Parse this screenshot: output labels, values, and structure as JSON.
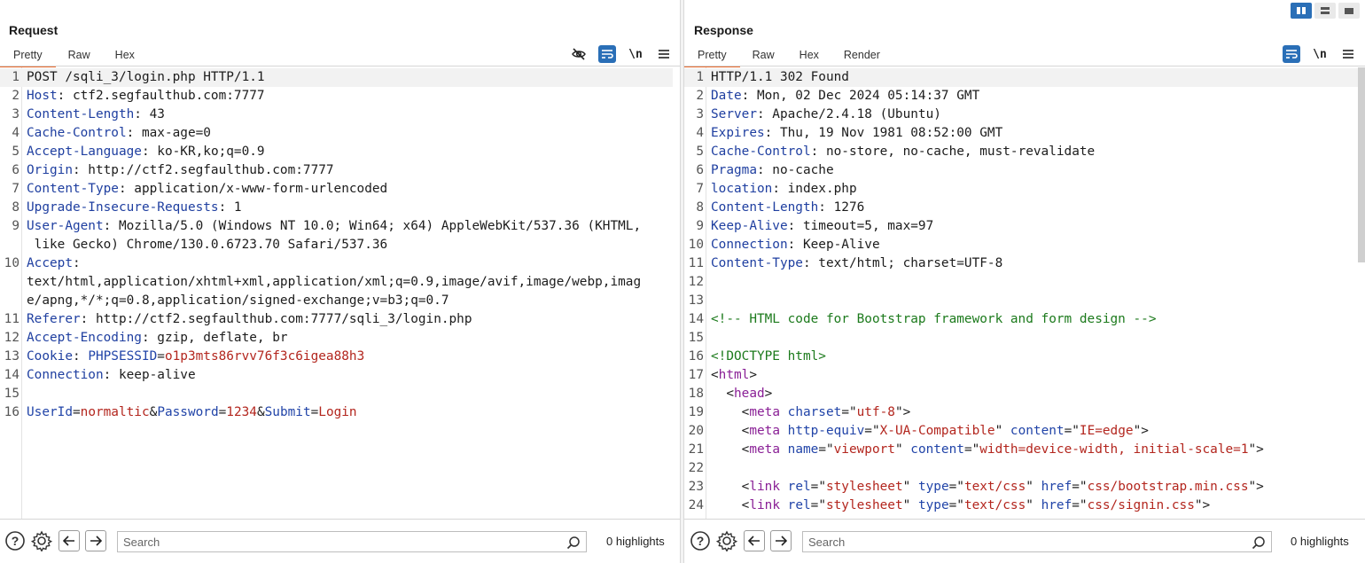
{
  "request": {
    "title": "Request",
    "tabs": [
      "Pretty",
      "Raw",
      "Hex"
    ],
    "toolbar": {
      "newline_label": "\\n"
    },
    "lines": [
      {
        "n": "1",
        "hl": true,
        "parts": [
          [
            "t",
            "POST /sqli_3/login.php HTTP/1.1"
          ]
        ]
      },
      {
        "n": "2",
        "parts": [
          [
            "k",
            "Host"
          ],
          [
            "t",
            ": ctf2.segfaulthub.com:7777"
          ]
        ]
      },
      {
        "n": "3",
        "parts": [
          [
            "k",
            "Content-Length"
          ],
          [
            "t",
            ": 43"
          ]
        ]
      },
      {
        "n": "4",
        "parts": [
          [
            "k",
            "Cache-Control"
          ],
          [
            "t",
            ": max-age=0"
          ]
        ]
      },
      {
        "n": "5",
        "parts": [
          [
            "k",
            "Accept-Language"
          ],
          [
            "t",
            ": ko-KR,ko;q=0.9"
          ]
        ]
      },
      {
        "n": "6",
        "parts": [
          [
            "k",
            "Origin"
          ],
          [
            "t",
            ": http://ctf2.segfaulthub.com:7777"
          ]
        ]
      },
      {
        "n": "7",
        "parts": [
          [
            "k",
            "Content-Type"
          ],
          [
            "t",
            ": application/x-www-form-urlencoded"
          ]
        ]
      },
      {
        "n": "8",
        "parts": [
          [
            "k",
            "Upgrade-Insecure-Requests"
          ],
          [
            "t",
            ": 1"
          ]
        ]
      },
      {
        "n": "9",
        "parts": [
          [
            "k",
            "User-Agent"
          ],
          [
            "t",
            ": Mozilla/5.0 (Windows NT 10.0; Win64; x64) AppleWebKit/537.36 (KHTML,"
          ]
        ]
      },
      {
        "n": "",
        "parts": [
          [
            "t",
            " like Gecko) Chrome/130.0.6723.70 Safari/537.36"
          ]
        ]
      },
      {
        "n": "10",
        "parts": [
          [
            "k",
            "Accept"
          ],
          [
            "t",
            ":"
          ]
        ]
      },
      {
        "n": "",
        "parts": [
          [
            "t",
            "text/html,application/xhtml+xml,application/xml;q=0.9,image/avif,image/webp,imag"
          ]
        ]
      },
      {
        "n": "",
        "parts": [
          [
            "t",
            "e/apng,*/*;q=0.8,application/signed-exchange;v=b3;q=0.7"
          ]
        ]
      },
      {
        "n": "11",
        "parts": [
          [
            "k",
            "Referer"
          ],
          [
            "t",
            ": http://ctf2.segfaulthub.com:7777/sqli_3/login.php"
          ]
        ]
      },
      {
        "n": "12",
        "parts": [
          [
            "k",
            "Accept-Encoding"
          ],
          [
            "t",
            ": gzip, deflate, br"
          ]
        ]
      },
      {
        "n": "13",
        "parts": [
          [
            "k",
            "Cookie"
          ],
          [
            "t",
            ": "
          ],
          [
            "pk",
            "PHPSESSID"
          ],
          [
            "t",
            "="
          ],
          [
            "pv",
            "o1p3mts86rvv76f3c6igea88h3"
          ]
        ]
      },
      {
        "n": "14",
        "parts": [
          [
            "k",
            "Connection"
          ],
          [
            "t",
            ": keep-alive"
          ]
        ]
      },
      {
        "n": "15",
        "parts": [
          [
            "t",
            ""
          ]
        ]
      },
      {
        "n": "16",
        "parts": [
          [
            "pk",
            "UserId"
          ],
          [
            "t",
            "="
          ],
          [
            "pv",
            "normaltic"
          ],
          [
            "t",
            "&"
          ],
          [
            "pk",
            "Password"
          ],
          [
            "t",
            "="
          ],
          [
            "pv",
            "1234"
          ],
          [
            "t",
            "&"
          ],
          [
            "pk",
            "Submit"
          ],
          [
            "t",
            "="
          ],
          [
            "pv",
            "Login"
          ]
        ]
      }
    ],
    "search_placeholder": "Search",
    "highlights": "0 highlights"
  },
  "response": {
    "title": "Response",
    "tabs": [
      "Pretty",
      "Raw",
      "Hex",
      "Render"
    ],
    "toolbar": {
      "newline_label": "\\n"
    },
    "lines": [
      {
        "n": "1",
        "hl": true,
        "parts": [
          [
            "t",
            "HTTP/1.1 302 Found"
          ]
        ]
      },
      {
        "n": "2",
        "parts": [
          [
            "k",
            "Date"
          ],
          [
            "t",
            ": Mon, 02 Dec 2024 05:14:37 GMT"
          ]
        ]
      },
      {
        "n": "3",
        "parts": [
          [
            "k",
            "Server"
          ],
          [
            "t",
            ": Apache/2.4.18 (Ubuntu)"
          ]
        ]
      },
      {
        "n": "4",
        "parts": [
          [
            "k",
            "Expires"
          ],
          [
            "t",
            ": Thu, 19 Nov 1981 08:52:00 GMT"
          ]
        ]
      },
      {
        "n": "5",
        "parts": [
          [
            "k",
            "Cache-Control"
          ],
          [
            "t",
            ": no-store, no-cache, must-revalidate"
          ]
        ]
      },
      {
        "n": "6",
        "parts": [
          [
            "k",
            "Pragma"
          ],
          [
            "t",
            ": no-cache"
          ]
        ]
      },
      {
        "n": "7",
        "parts": [
          [
            "k",
            "location"
          ],
          [
            "t",
            ": index.php"
          ]
        ]
      },
      {
        "n": "8",
        "parts": [
          [
            "k",
            "Content-Length"
          ],
          [
            "t",
            ": 1276"
          ]
        ]
      },
      {
        "n": "9",
        "parts": [
          [
            "k",
            "Keep-Alive"
          ],
          [
            "t",
            ": timeout=5, max=97"
          ]
        ]
      },
      {
        "n": "10",
        "parts": [
          [
            "k",
            "Connection"
          ],
          [
            "t",
            ": Keep-Alive"
          ]
        ]
      },
      {
        "n": "11",
        "parts": [
          [
            "k",
            "Content-Type"
          ],
          [
            "t",
            ": text/html; charset=UTF-8"
          ]
        ]
      },
      {
        "n": "12",
        "parts": [
          [
            "t",
            ""
          ]
        ]
      },
      {
        "n": "13",
        "parts": [
          [
            "t",
            ""
          ]
        ]
      },
      {
        "n": "14",
        "parts": [
          [
            "cm",
            "<!-- HTML code for Bootstrap framework and form design -->"
          ]
        ]
      },
      {
        "n": "15",
        "parts": [
          [
            "t",
            ""
          ]
        ]
      },
      {
        "n": "16",
        "parts": [
          [
            "cm",
            "<!DOCTYPE html>"
          ]
        ]
      },
      {
        "n": "17",
        "parts": [
          [
            "t",
            "<"
          ],
          [
            "tg",
            "html"
          ],
          [
            "t",
            ">"
          ]
        ]
      },
      {
        "n": "18",
        "parts": [
          [
            "t",
            "  <"
          ],
          [
            "tg",
            "head"
          ],
          [
            "t",
            ">"
          ]
        ]
      },
      {
        "n": "19",
        "parts": [
          [
            "t",
            "    <"
          ],
          [
            "tg",
            "meta"
          ],
          [
            "t",
            " "
          ],
          [
            "at",
            "charset"
          ],
          [
            "t",
            "=\""
          ],
          [
            "av",
            "utf-8"
          ],
          [
            "t",
            "\">"
          ]
        ]
      },
      {
        "n": "20",
        "parts": [
          [
            "t",
            "    <"
          ],
          [
            "tg",
            "meta"
          ],
          [
            "t",
            " "
          ],
          [
            "at",
            "http-equiv"
          ],
          [
            "t",
            "=\""
          ],
          [
            "av",
            "X-UA-Compatible"
          ],
          [
            "t",
            "\" "
          ],
          [
            "at",
            "content"
          ],
          [
            "t",
            "=\""
          ],
          [
            "av",
            "IE=edge"
          ],
          [
            "t",
            "\">"
          ]
        ]
      },
      {
        "n": "21",
        "parts": [
          [
            "t",
            "    <"
          ],
          [
            "tg",
            "meta"
          ],
          [
            "t",
            " "
          ],
          [
            "at",
            "name"
          ],
          [
            "t",
            "=\""
          ],
          [
            "av",
            "viewport"
          ],
          [
            "t",
            "\" "
          ],
          [
            "at",
            "content"
          ],
          [
            "t",
            "=\""
          ],
          [
            "av",
            "width=device-width, initial-scale=1"
          ],
          [
            "t",
            "\">"
          ]
        ]
      },
      {
        "n": "22",
        "parts": [
          [
            "t",
            ""
          ]
        ]
      },
      {
        "n": "23",
        "parts": [
          [
            "t",
            "    <"
          ],
          [
            "tg",
            "link"
          ],
          [
            "t",
            " "
          ],
          [
            "at",
            "rel"
          ],
          [
            "t",
            "=\""
          ],
          [
            "av",
            "stylesheet"
          ],
          [
            "t",
            "\" "
          ],
          [
            "at",
            "type"
          ],
          [
            "t",
            "=\""
          ],
          [
            "av",
            "text/css"
          ],
          [
            "t",
            "\" "
          ],
          [
            "at",
            "href"
          ],
          [
            "t",
            "=\""
          ],
          [
            "av",
            "css/bootstrap.min.css"
          ],
          [
            "t",
            "\">"
          ]
        ]
      },
      {
        "n": "24",
        "parts": [
          [
            "t",
            "    <"
          ],
          [
            "tg",
            "link"
          ],
          [
            "t",
            " "
          ],
          [
            "at",
            "rel"
          ],
          [
            "t",
            "=\""
          ],
          [
            "av",
            "stylesheet"
          ],
          [
            "t",
            "\" "
          ],
          [
            "at",
            "type"
          ],
          [
            "t",
            "=\""
          ],
          [
            "av",
            "text/css"
          ],
          [
            "t",
            "\" "
          ],
          [
            "at",
            "href"
          ],
          [
            "t",
            "=\""
          ],
          [
            "av",
            "css/signin.css"
          ],
          [
            "t",
            "\">"
          ]
        ]
      }
    ],
    "search_placeholder": "Search",
    "highlights": "0 highlights"
  },
  "icons": {
    "hide": "eye-off-icon",
    "wrap": "word-wrap-icon",
    "menu": "hamburger-menu-icon",
    "help": "help-icon",
    "settings": "gear-icon",
    "back": "arrow-left-icon",
    "forward": "arrow-right-icon",
    "search": "search-icon",
    "layout_split": "layout-split-columns-icon",
    "layout_rows": "layout-rows-icon",
    "layout_tabs": "layout-tabs-icon"
  },
  "colors": {
    "accent": "#e8692b",
    "active_blue": "#2a6fb7"
  }
}
